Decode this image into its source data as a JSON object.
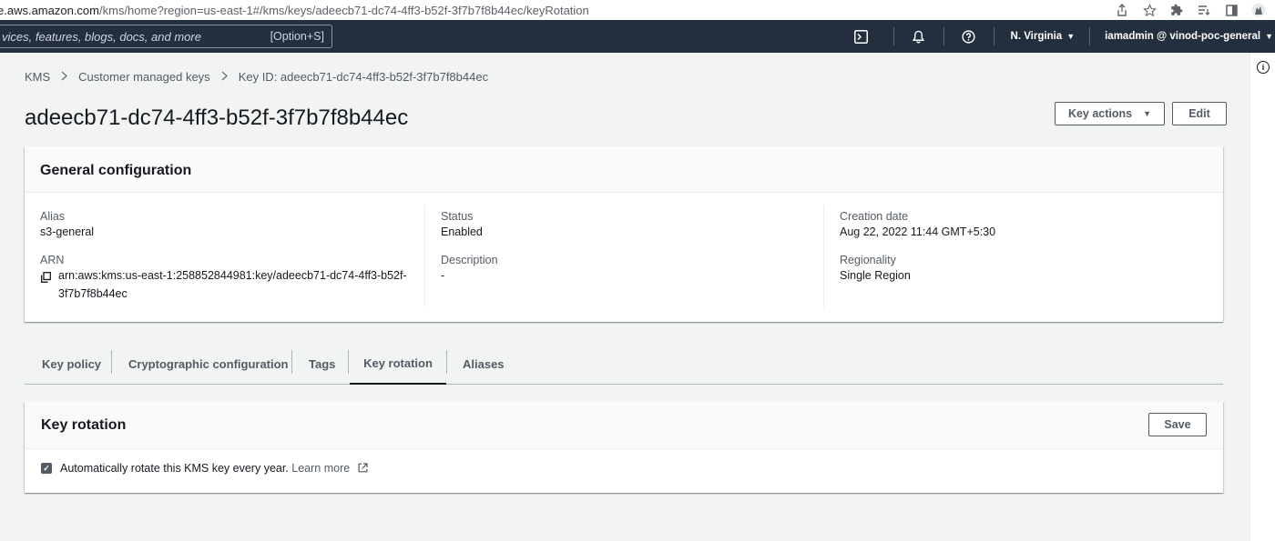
{
  "browser": {
    "url_host": "e.aws.amazon.com",
    "url_path": "/kms/home?region=us-east-1#/kms/keys/adeecb71-dc74-4ff3-b52f-3f7b7f8b44ec/keyRotation",
    "icons": [
      "share-icon",
      "star-icon",
      "extensions-icon",
      "reading-list-icon",
      "sidepanel-icon",
      "profile-icon"
    ]
  },
  "topnav": {
    "search_placeholder": "vices, features, blogs, docs, and more",
    "search_shortcut": "[Option+S]",
    "region": "N. Virginia",
    "account": "iamadmin @ vinod-poc-general",
    "icons": [
      "cloudshell-icon",
      "bell-icon",
      "help-icon"
    ]
  },
  "breadcrumb": {
    "items": [
      "KMS",
      "Customer managed keys",
      "Key ID: adeecb71-dc74-4ff3-b52f-3f7b7f8b44ec"
    ]
  },
  "page": {
    "title": "adeecb71-dc74-4ff3-b52f-3f7b7f8b44ec",
    "key_actions_label": "Key actions",
    "edit_label": "Edit"
  },
  "general_config": {
    "title": "General configuration",
    "alias_label": "Alias",
    "alias_value": "s3-general",
    "arn_label": "ARN",
    "arn_line1": "arn:aws:kms:us-east-1:258852844981:key/adeecb71-dc74-4ff3-b52f-",
    "arn_line2": "3f7b7f8b44ec",
    "status_label": "Status",
    "status_value": "Enabled",
    "description_label": "Description",
    "description_value": "-",
    "creation_label": "Creation date",
    "creation_value": "Aug 22, 2022 11:44 GMT+5:30",
    "regionality_label": "Regionality",
    "regionality_value": "Single Region"
  },
  "tabs": [
    {
      "label": "Key policy"
    },
    {
      "label": "Cryptographic configuration"
    },
    {
      "label": "Tags"
    },
    {
      "label": "Key rotation"
    },
    {
      "label": "Aliases"
    }
  ],
  "active_tab": "Key rotation",
  "key_rotation": {
    "title": "Key rotation",
    "save_label": "Save",
    "checkbox_checked": true,
    "checkbox_label": "Automatically rotate this KMS key every year.",
    "learn_more": "Learn more"
  },
  "colors": {
    "nav_bg": "#232f3e",
    "page_bg": "#f2f3f3",
    "text": "#16191f",
    "muted": "#545b64"
  }
}
